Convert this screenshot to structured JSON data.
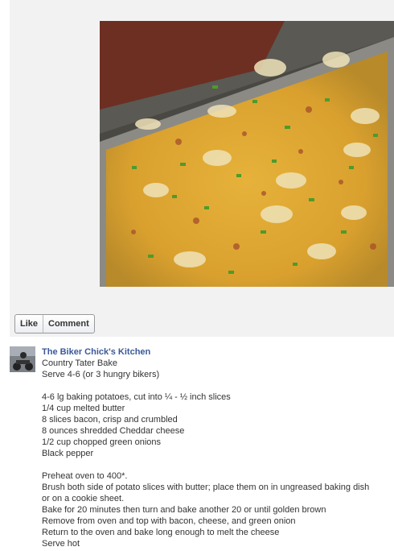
{
  "actions": {
    "like_label": "Like",
    "comment_label": "Comment"
  },
  "post": {
    "author": "The Biker Chick's Kitchen",
    "title": "Country Tater Bake",
    "serves": "Serve 4-6 (or 3 hungry bikers)",
    "ingredients": [
      "4-6 lg baking potatoes, cut into ¼ - ½ inch slices",
      "1/4 cup melted butter",
      "8 slices bacon, crisp and crumbled",
      "8 ounces shredded Cheddar cheese",
      "1/2 cup chopped green onions",
      "Black pepper"
    ],
    "steps": [
      "Preheat oven to 400*.",
      "Brush both side of potato slices with butter; place them on in ungreased baking dish",
      "or on a cookie sheet.",
      "Bake for 20 minutes then turn and bake another 20 or until golden brown",
      "Remove from oven and top with bacon, cheese, and green onion",
      "Return to the oven and bake long enough to melt the cheese",
      "Serve hot"
    ]
  },
  "colors": {
    "link": "#3b5998",
    "panel": "#f2f2f2"
  }
}
